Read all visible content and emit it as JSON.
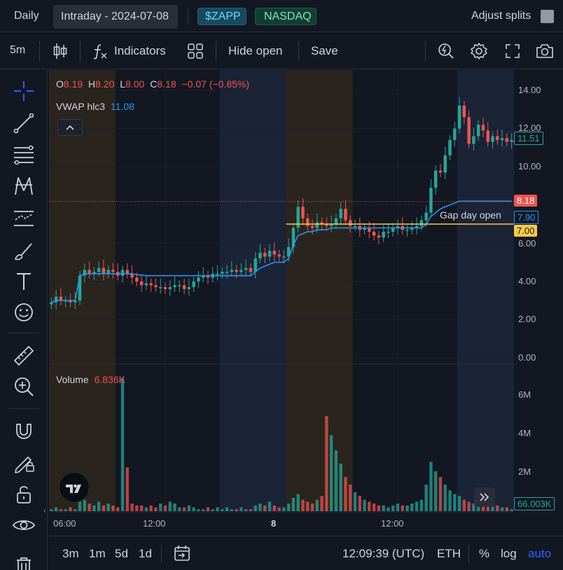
{
  "topbar": {
    "timeframe_tab": "Daily",
    "session_tab": "Intraday - 2024-07-08",
    "ticker_badge": "$ZAPP",
    "exchange_badge": "NASDAQ",
    "adjust_splits_label": "Adjust splits"
  },
  "toolbar": {
    "interval": "5m",
    "indicators_label": "Indicators",
    "hide_open_label": "Hide open",
    "save_label": "Save"
  },
  "legend": {
    "o_label": "O",
    "o_value": "8.19",
    "h_label": "H",
    "h_value": "8.20",
    "l_label": "L",
    "l_value": "8.00",
    "c_label": "C",
    "c_value": "8.18",
    "change": "−0.07 (−0.85%)",
    "vwap_label": "VWAP hlc3",
    "vwap_value": "11.08",
    "volume_label": "Volume",
    "volume_value": "6.836K"
  },
  "price_axis": {
    "ticks": [
      "14.00",
      "12.00",
      "10.00",
      "6.00",
      "4.00",
      "2.00",
      "0.00"
    ],
    "tag_vwap": "11.51",
    "tag_last": "8.18",
    "tag_gapline": "7.90",
    "tag_gap": "7.00",
    "gap_day_label": "Gap day open"
  },
  "volume_axis": {
    "ticks": [
      "6M",
      "4M",
      "2M"
    ],
    "tag_volume": "66.003K"
  },
  "time_axis": {
    "ticks": [
      "06:00",
      "12:00",
      "8",
      "12:00"
    ]
  },
  "bottombar": {
    "ranges": [
      "3m",
      "1m",
      "5d",
      "1d"
    ],
    "clock": "12:09:39 (UTC)",
    "session": "ETH",
    "percent": "%",
    "log": "log",
    "auto": "auto"
  },
  "colors": {
    "up": "#26a69a",
    "down": "#ef5350",
    "vwap": "#2196f3",
    "gap": "#f7c948",
    "premarket_bg": "#2a241e",
    "afterhours_bg": "#1b2337",
    "accent": "#2962ff"
  },
  "chart_data": {
    "type": "candlestick",
    "symbol": "$ZAPP",
    "interval": "5m",
    "ylim": [
      0,
      15
    ],
    "price_points": [
      2.9,
      3.2,
      3.0,
      3.0,
      2.9,
      3.0,
      4.3,
      4.6,
      4.4,
      4.5,
      4.7,
      4.4,
      4.6,
      4.5,
      4.3,
      4.6,
      4.4,
      4.2,
      4.0,
      3.8,
      3.9,
      3.8,
      3.7,
      3.7,
      3.6,
      3.7,
      3.8,
      3.8,
      3.6,
      3.7,
      4.0,
      4.2,
      4.3,
      4.2,
      4.4,
      4.4,
      4.5,
      4.5,
      4.6,
      4.5,
      4.6,
      4.7,
      4.5,
      5.2,
      5.5,
      5.3,
      5.6,
      5.4,
      5.3,
      5.3,
      5.8,
      6.8,
      7.9,
      7.3,
      6.9,
      6.8,
      7.1,
      7.0,
      6.9,
      7.0,
      7.3,
      7.8,
      7.2,
      6.9,
      6.9,
      6.7,
      6.8,
      6.6,
      6.4,
      6.3,
      6.6,
      6.6,
      6.8,
      6.9,
      6.7,
      6.7,
      6.8,
      6.9,
      7.2,
      7.6,
      8.9,
      9.8,
      9.7,
      10.6,
      11.4,
      12.0,
      13.2,
      12.6,
      11.2,
      11.6,
      12.2,
      11.9,
      11.3,
      11.6,
      11.4,
      11.5,
      11.3,
      11.4
    ],
    "vwap": [
      2.9,
      3.0,
      3.0,
      3.0,
      3.0,
      3.0,
      4.3,
      4.4,
      4.4,
      4.4,
      4.4,
      4.4,
      4.4,
      4.4,
      4.4,
      4.4,
      4.4,
      4.4,
      4.35,
      4.33,
      4.3,
      4.3,
      4.3,
      4.3,
      4.3,
      4.3,
      4.3,
      4.3,
      4.3,
      4.3,
      4.3,
      4.3,
      4.3,
      4.3,
      4.3,
      4.3,
      4.3,
      4.3,
      4.3,
      4.3,
      4.3,
      4.3,
      4.3,
      4.5,
      4.7,
      4.8,
      4.9,
      5.0,
      5.0,
      5.0,
      5.2,
      5.9,
      6.4,
      6.5,
      6.6,
      6.6,
      6.7,
      6.7,
      6.7,
      6.8,
      6.8,
      6.8,
      6.8,
      6.8,
      6.8,
      6.8,
      6.8,
      6.8,
      6.8,
      6.8,
      6.8,
      6.8,
      6.8,
      6.8,
      6.8,
      6.8,
      6.8,
      6.8,
      6.8,
      7.0,
      7.4,
      7.6,
      7.8,
      7.9,
      8.0,
      8.1,
      8.2,
      8.2,
      8.2,
      8.2,
      8.2,
      8.2,
      8.2,
      8.2,
      8.2,
      8.2,
      8.2,
      8.2
    ],
    "volume_ylim": [
      0,
      7
    ],
    "volume_m": [
      0.1,
      0.2,
      0.1,
      0.1,
      0.2,
      0.1,
      0.8,
      0.6,
      0.4,
      0.3,
      0.5,
      0.3,
      0.4,
      0.3,
      0.2,
      7.0,
      2.3,
      0.4,
      0.3,
      0.3,
      0.2,
      0.3,
      0.2,
      0.4,
      0.3,
      0.5,
      0.4,
      0.2,
      0.2,
      0.3,
      0.2,
      0.1,
      0.1,
      0.2,
      0.1,
      0.2,
      0.1,
      0.2,
      0.1,
      0.1,
      0.2,
      0.1,
      0.1,
      0.3,
      0.4,
      0.3,
      0.5,
      0.3,
      0.2,
      0.2,
      0.4,
      0.7,
      0.9,
      0.6,
      0.5,
      0.4,
      0.6,
      0.8,
      5.0,
      4.0,
      3.2,
      2.5,
      1.8,
      1.4,
      1.0,
      0.8,
      0.6,
      0.5,
      0.4,
      0.3,
      0.3,
      0.2,
      0.3,
      0.4,
      0.3,
      0.3,
      0.4,
      0.5,
      0.6,
      1.4,
      2.6,
      2.1,
      1.8,
      1.4,
      1.1,
      0.9,
      0.8,
      0.6,
      0.5,
      0.4,
      0.6,
      0.5,
      0.4,
      0.3,
      0.3,
      0.2,
      0.2,
      0.1
    ],
    "gap_day_open": 7.0,
    "last_price": 8.18
  }
}
